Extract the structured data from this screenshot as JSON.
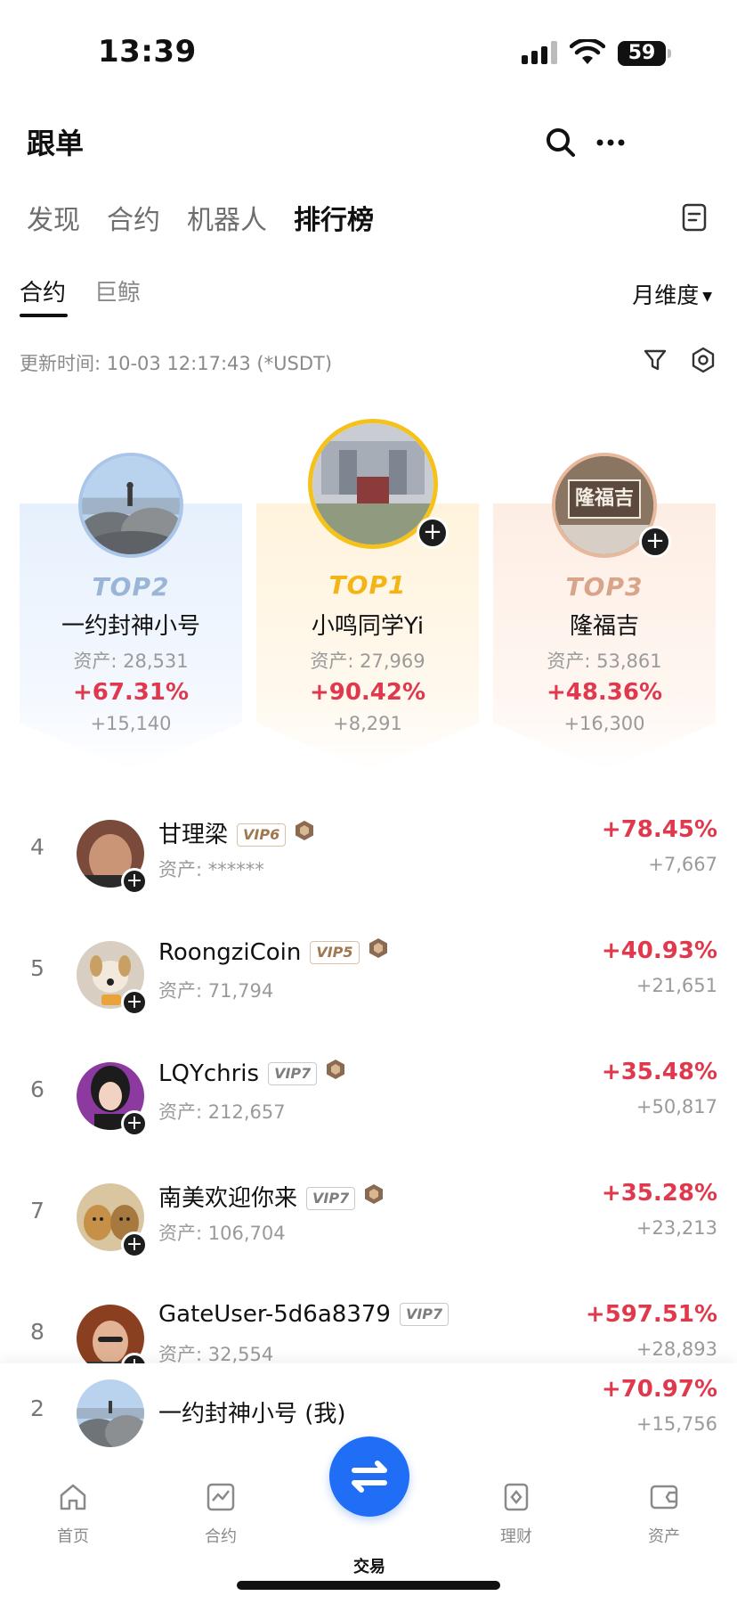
{
  "status_bar": {
    "time": "13:39",
    "battery": "59"
  },
  "header": {
    "title": "跟单",
    "search_icon": "search-icon",
    "more_icon": "more-icon"
  },
  "top_tabs": [
    "发现",
    "合约",
    "机器人",
    "排行榜"
  ],
  "top_tab_active": "排行榜",
  "sub_tabs": [
    "合约",
    "巨鲸"
  ],
  "sub_tab_active": "合约",
  "period": {
    "label": "月维度"
  },
  "update_text": "更新时间: 10-03 12:17:43 (*USDT)",
  "podium": {
    "top2": {
      "rank": "TOP2",
      "name": "一约封神小号",
      "assets": "资产: 28,531",
      "pct": "+67.31%",
      "abs": "+15,140"
    },
    "top1": {
      "rank": "TOP1",
      "name": "小鸣同学Yi",
      "assets": "资产: 27,969",
      "pct": "+90.42%",
      "abs": "+8,291"
    },
    "top3": {
      "rank": "TOP3",
      "name": "隆福吉",
      "assets": "资产: 53,861",
      "pct": "+48.36%",
      "abs": "+16,300",
      "avatar_text": "隆福吉"
    }
  },
  "list": [
    {
      "index": "4",
      "name": "甘理梁",
      "vip": "VIP6",
      "assets": "资产: ******",
      "pct": "+78.45%",
      "abs": "+7,667"
    },
    {
      "index": "5",
      "name": "RoongziCoin",
      "vip": "VIP5",
      "assets": "资产: 71,794",
      "pct": "+40.93%",
      "abs": "+21,651"
    },
    {
      "index": "6",
      "name": "LQYchris",
      "vip": "VIP7",
      "assets": "资产: 212,657",
      "pct": "+35.48%",
      "abs": "+50,817"
    },
    {
      "index": "7",
      "name": "南美欢迎你来",
      "vip": "VIP7",
      "assets": "资产: 106,704",
      "pct": "+35.28%",
      "abs": "+23,213"
    },
    {
      "index": "8",
      "name": "GateUser-5d6a8379",
      "vip": "VIP7",
      "assets": "资产: 32,554",
      "pct": "+597.51%",
      "abs": "+28,893"
    }
  ],
  "my_rank": {
    "index": "2",
    "name": "一约封神小号 (我)",
    "pct": "+70.97%",
    "abs": "+15,756"
  },
  "bottom_nav": {
    "home": "首页",
    "contract": "合约",
    "trade": "交易",
    "finance": "理财",
    "assets": "资产"
  },
  "colors": {
    "accent": "#1f6ef5",
    "gain": "#e0394d",
    "gold": "#f3b417"
  }
}
